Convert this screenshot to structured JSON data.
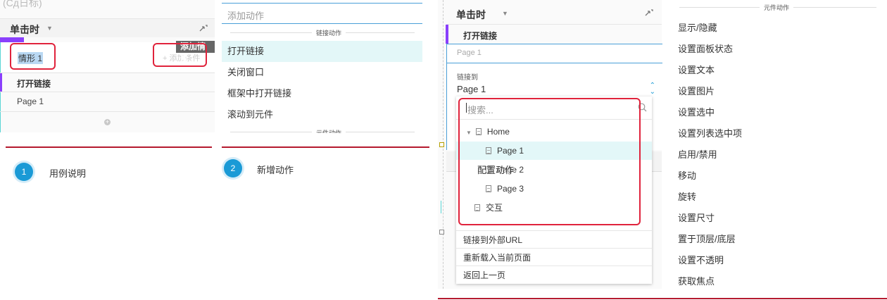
{
  "panel1": {
    "top_partial": "(Сд日标)",
    "event_label": "单击时",
    "case_name": "情形 1",
    "add_case_button": "添加情形",
    "add_case_faint": "+ 添加条件",
    "action_title": "打开链接",
    "action_target": "Page 1",
    "add_icon": "plus-circle-icon"
  },
  "panel2": {
    "search_placeholder": "添加动作",
    "section_link": "链接动作",
    "items": [
      "打开链接",
      "关闭窗口",
      "框架中打开链接",
      "滚动到元件"
    ],
    "section_widget_partial": "元件动作"
  },
  "steps": [
    {
      "num": "1",
      "text": "用例说明"
    },
    {
      "num": "2",
      "text": "新增动作"
    }
  ],
  "panel3": {
    "event_label": "单击时",
    "action_title": "打开链接",
    "action_target_faint": "Page 1",
    "link_to_label": "链接到",
    "link_to_value": "Page 1",
    "search_placeholder": "搜索...",
    "tree": {
      "home": "Home",
      "page1": "Page 1",
      "page2": "Page 2",
      "page2_overlay": "配置动作",
      "page3": "Page 3",
      "jiaohu": "交互"
    },
    "bottom_items": [
      "链接到外部URL",
      "重新载入当前页面",
      "返回上一页"
    ]
  },
  "panel4": {
    "section_title": "元件动作",
    "items": [
      "显示/隐藏",
      "设置面板状态",
      "设置文本",
      "设置图片",
      "设置选中",
      "设置列表选中项",
      "启用/禁用",
      "移动",
      "旋转",
      "设置尺寸",
      "置于顶层/底层",
      "设置不透明",
      "获取焦点"
    ]
  },
  "colors": {
    "accent_purple": "#8a3ffc",
    "teal": "#5ad5d5",
    "red": "#e0233c",
    "blue": "#1a9ad6",
    "highlight": "#e3f7f8"
  }
}
